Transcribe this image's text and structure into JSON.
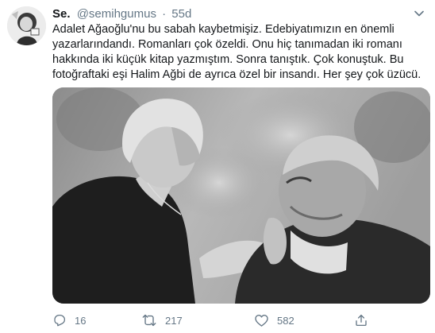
{
  "tweet": {
    "display_name": "Se.",
    "handle": "@semihgumus",
    "separator": "·",
    "time": "55d",
    "lines": [
      "Adalet Ağaoğlu'nu bu sabah kaybetmişiz. Edebiyatımızın en önemli",
      "yazarlarındandı. Romanları çok özeldi. Onu hiç tanımadan iki romanı",
      "hakkında iki küçük kitap yazmıştım. Sonra tanıştık. Çok konuştuk. Bu",
      "fotoğraftaki eşi Halim Ağbi de ayrıca özel bir insandı. Her şey çok üzücü."
    ]
  },
  "actions": {
    "reply_count": "16",
    "retweet_count": "217",
    "like_count": "582"
  },
  "icons": {
    "reply": "reply-icon",
    "retweet": "retweet-icon",
    "like": "heart-icon",
    "share": "share-icon",
    "caret": "chevron-down-icon"
  },
  "colors": {
    "text": "#14171a",
    "secondary": "#657786"
  }
}
